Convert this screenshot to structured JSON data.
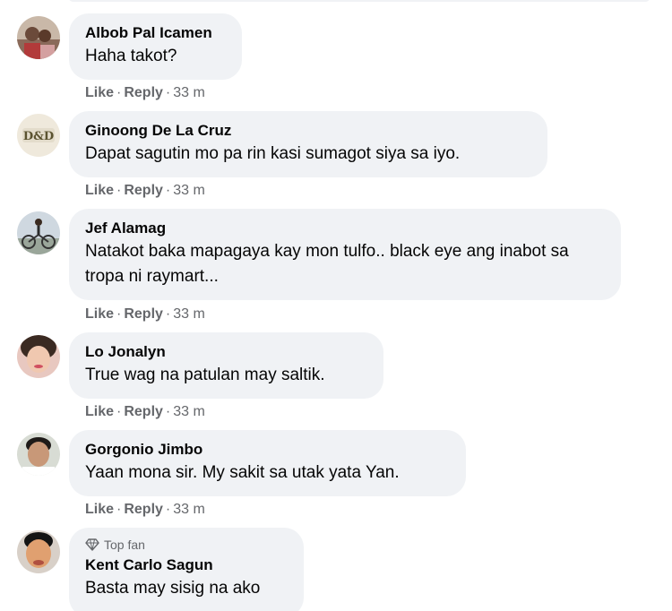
{
  "comments": [
    {
      "author": "Albob Pal Icamen",
      "text": "Haha takot?",
      "like": "Like",
      "reply": "Reply",
      "time": "33 m",
      "sep": "·"
    },
    {
      "author": "Ginoong De La Cruz",
      "text": "Dapat sagutin mo pa rin kasi sumagot siya sa iyo.",
      "avatar_text": "D&D",
      "like": "Like",
      "reply": "Reply",
      "time": "33 m",
      "sep": "·"
    },
    {
      "author": "Jef Alamag",
      "text": "Natakot baka mapagaya kay mon tulfo.. black eye ang inabot sa tropa ni raymart...",
      "like": "Like",
      "reply": "Reply",
      "time": "33 m",
      "sep": "·"
    },
    {
      "author": "Lo Jonalyn",
      "text": "True wag na patulan may saltik.",
      "like": "Like",
      "reply": "Reply",
      "time": "33 m",
      "sep": "·"
    },
    {
      "author": "Gorgonio Jimbo",
      "text": "Yaan mona sir. My sakit sa utak yata Yan.",
      "like": "Like",
      "reply": "Reply",
      "time": "33 m",
      "sep": "·"
    },
    {
      "author": "Kent Carlo Sagun",
      "badge": "Top fan",
      "text": "Basta may sisig na ako"
    }
  ],
  "colors": {
    "bubble": "#f0f2f5",
    "name": "#050505",
    "meta": "#65676b"
  }
}
